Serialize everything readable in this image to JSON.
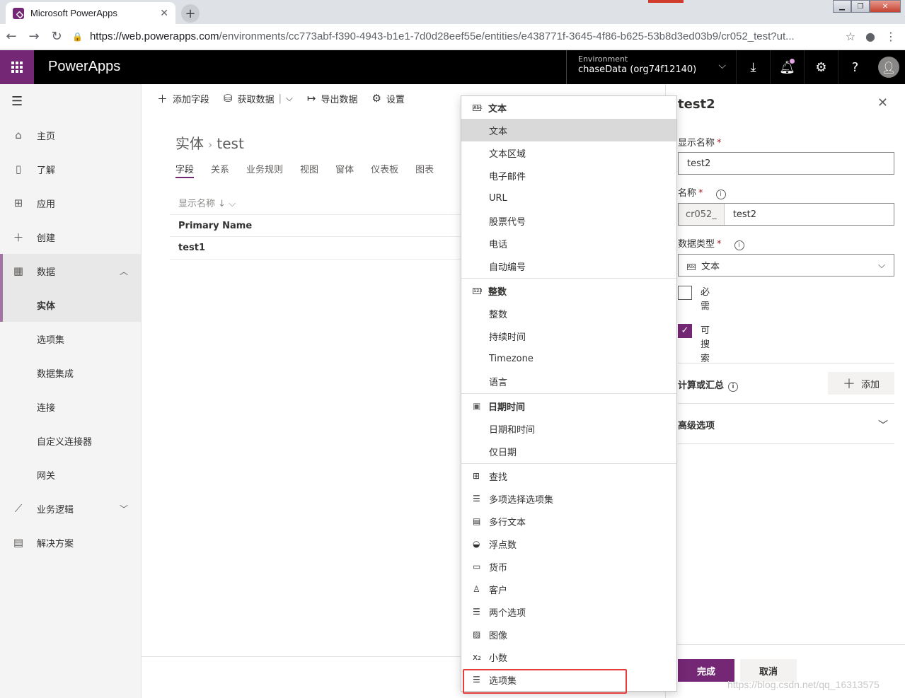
{
  "browser": {
    "tab_title": "Microsoft PowerApps",
    "url_host": "https://web.powerapps.com",
    "url_path": "/environments/cc773abf-f390-4943-b1e1-7d0d28eef55e/entities/e438771f-3645-4f86-b625-53b8d3ed03b9/cr052_test?ut..."
  },
  "header": {
    "brand": "PowerApps",
    "env_label": "Environment",
    "env_value": "chaseData (org74f12140)",
    "accent": "#742774"
  },
  "leftnav": {
    "items": [
      {
        "label": "主页"
      },
      {
        "label": "了解"
      },
      {
        "label": "应用"
      },
      {
        "label": "创建"
      },
      {
        "label": "数据"
      },
      {
        "label": "实体"
      },
      {
        "label": "选项集"
      },
      {
        "label": "数据集成"
      },
      {
        "label": "连接"
      },
      {
        "label": "自定义连接器"
      },
      {
        "label": "网关"
      },
      {
        "label": "业务逻辑"
      },
      {
        "label": "解决方案"
      }
    ]
  },
  "cmdbar": {
    "add_field": "添加字段",
    "get_data": "获取数据",
    "export_data": "导出数据",
    "settings": "设置"
  },
  "main": {
    "crumb_root": "实体",
    "crumb_leaf": "test",
    "tabs": [
      "字段",
      "关系",
      "业务规则",
      "视图",
      "窗体",
      "仪表板",
      "图表"
    ],
    "col_header": "显示名称",
    "rows": [
      "Primary Name",
      "test1"
    ]
  },
  "menu": {
    "groups": [
      {
        "header": "文本",
        "items": [
          "文本",
          "文本区域",
          "电子邮件",
          "URL",
          "股票代号",
          "电话",
          "自动编号"
        ]
      },
      {
        "header": "整数",
        "items": [
          "整数",
          "持续时间",
          "Timezone",
          "语言"
        ]
      },
      {
        "header": "日期时间",
        "items": [
          "日期和时间",
          "仅日期"
        ]
      }
    ],
    "others": [
      "查找",
      "多项选择选项集",
      "多行文本",
      "浮点数",
      "货币",
      "客户",
      "两个选项",
      "图像",
      "小数",
      "选项集"
    ]
  },
  "panel": {
    "title": "test2",
    "display_name_label": "显示名称",
    "display_name_value": "test2",
    "name_label": "名称",
    "name_prefix": "cr052_",
    "name_value": "test2",
    "datatype_label": "数据类型",
    "datatype_value": "文本",
    "required_label": "必需",
    "searchable_label": "可搜索",
    "calc_label": "计算或汇总",
    "add_label": "添加",
    "advanced_label": "高级选项",
    "done": "完成",
    "cancel": "取消"
  },
  "watermark": "https://blog.csdn.net/qq_16313575"
}
